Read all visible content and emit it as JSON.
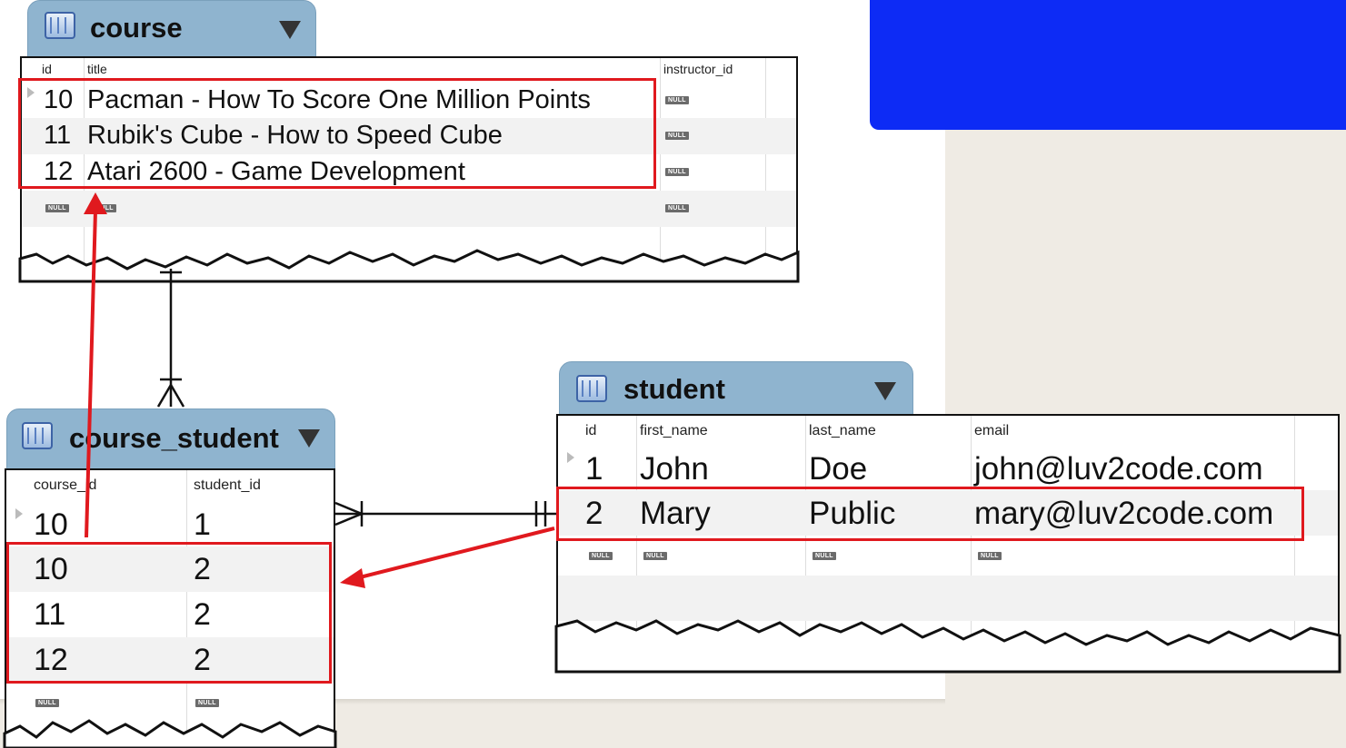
{
  "course": {
    "name": "course",
    "columns": [
      "id",
      "title",
      "instructor_id"
    ],
    "rows": [
      {
        "id": "10",
        "title": "Pacman - How To Score One Million Points",
        "instructor_id": "NULL"
      },
      {
        "id": "11",
        "title": "Rubik's Cube - How to Speed Cube",
        "instructor_id": "NULL"
      },
      {
        "id": "12",
        "title": "Atari 2600 - Game Development",
        "instructor_id": "NULL"
      },
      {
        "id": "NULL",
        "title": "NULL",
        "instructor_id": "NULL"
      }
    ]
  },
  "course_student": {
    "name": "course_student",
    "columns": [
      "course_id",
      "student_id"
    ],
    "rows": [
      {
        "course_id": "10",
        "student_id": "1"
      },
      {
        "course_id": "10",
        "student_id": "2"
      },
      {
        "course_id": "11",
        "student_id": "2"
      },
      {
        "course_id": "12",
        "student_id": "2"
      },
      {
        "course_id": "NULL",
        "student_id": "NULL"
      }
    ]
  },
  "student": {
    "name": "student",
    "columns": [
      "id",
      "first_name",
      "last_name",
      "email"
    ],
    "rows": [
      {
        "id": "1",
        "first_name": "John",
        "last_name": "Doe",
        "email": "john@luv2code.com"
      },
      {
        "id": "2",
        "first_name": "Mary",
        "last_name": "Public",
        "email": "mary@luv2code.com"
      },
      {
        "id": "NULL",
        "first_name": "NULL",
        "last_name": "NULL",
        "email": "NULL"
      }
    ]
  },
  "colors": {
    "highlight": "#e0191e",
    "header": "#8fb4cf",
    "accent_box": "#0d2bf5"
  }
}
